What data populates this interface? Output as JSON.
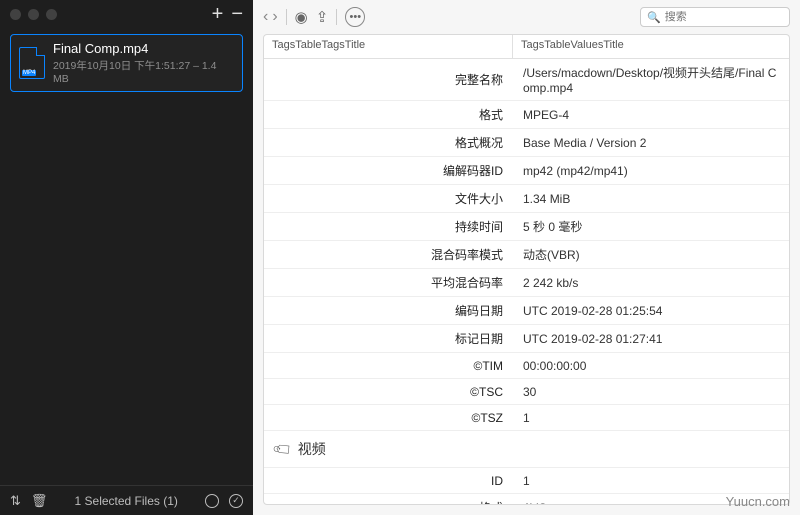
{
  "sidebar": {
    "file": {
      "ext": "MP4",
      "name": "Final Comp.mp4",
      "meta": "2019年10月10日 下午1:51:27 – 1.4 MB"
    },
    "footer": {
      "selected": "1 Selected Files (1)"
    }
  },
  "search": {
    "placeholder": "搜索"
  },
  "table": {
    "header_tags": "TagsTableTagsTitle",
    "header_values": "TagsTableValuesTitle",
    "rows": [
      {
        "k": "完整名称",
        "v": "/Users/macdown/Desktop/视频开头结尾/Final Comp.mp4"
      },
      {
        "k": "格式",
        "v": "MPEG-4"
      },
      {
        "k": "格式概况",
        "v": "Base Media / Version 2"
      },
      {
        "k": "编解码器ID",
        "v": "mp42 (mp42/mp41)"
      },
      {
        "k": "文件大小",
        "v": "1.34 MiB"
      },
      {
        "k": "持续时间",
        "v": "5 秒 0 毫秒"
      },
      {
        "k": "混合码率模式",
        "v": "动态(VBR)"
      },
      {
        "k": "平均混合码率",
        "v": "2 242 kb/s"
      },
      {
        "k": "编码日期",
        "v": "UTC 2019-02-28 01:25:54"
      },
      {
        "k": "标记日期",
        "v": "UTC 2019-02-28 01:27:41"
      },
      {
        "k": "©TIM",
        "v": "00:00:00:00"
      },
      {
        "k": "©TSC",
        "v": "30"
      },
      {
        "k": "©TSZ",
        "v": "1"
      }
    ],
    "section2": "视频",
    "rows2": [
      {
        "k": "ID",
        "v": "1"
      },
      {
        "k": "格式",
        "v": "AVC"
      }
    ]
  },
  "watermark": "Yuucn.com"
}
